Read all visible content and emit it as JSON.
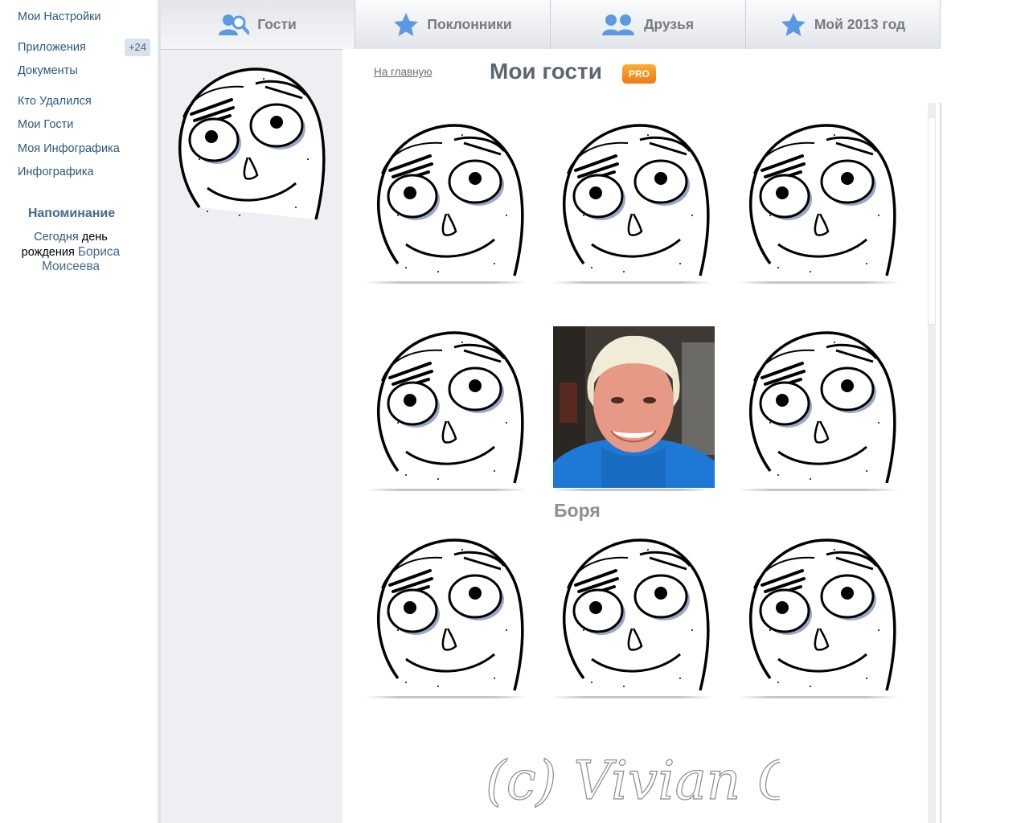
{
  "sidebar": {
    "settings": "Мои Настройки",
    "apps": "Приложения",
    "apps_badge": "+24",
    "documents": "Документы",
    "who_left": "Кто Удалился",
    "my_guests": "Мои Гости",
    "my_infographic": "Моя Инфографика",
    "infographic": "Инфографика",
    "reminder_title": "Напоминание",
    "reminder_today": "Сегодня",
    "reminder_day": "день",
    "reminder_birthday": "рождения",
    "reminder_name_first": "Бориса",
    "reminder_name_last": "Моисеева"
  },
  "tabs": [
    {
      "label": "Гости",
      "icon": "guests-icon"
    },
    {
      "label": "Поклонники",
      "icon": "star-icon"
    },
    {
      "label": "Друзья",
      "icon": "friends-icon"
    },
    {
      "label": "Мой 2013 год",
      "icon": "star-icon"
    }
  ],
  "main": {
    "home_link": "На главную",
    "title": "Мои гости",
    "pro_badge": "PRO",
    "guest_name": "Боря"
  },
  "signature": "(c) Vivian Cels",
  "colors": {
    "link": "#2b587a",
    "badge_bg": "#dae2ea",
    "pro_badge": "#f58a1f",
    "tab_icon": "#5b9ae0"
  }
}
